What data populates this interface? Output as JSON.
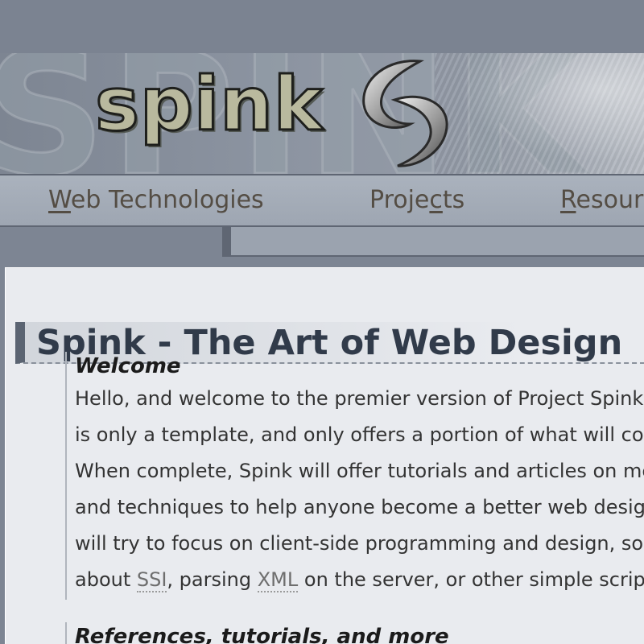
{
  "banner": {
    "logo_text": "spink",
    "ghost_text": "SPINK"
  },
  "nav": {
    "items": [
      {
        "label_key": "W",
        "label_rest": "eb Technologies"
      },
      {
        "label_pre": "Proje",
        "label_key": "c",
        "label_rest": "ts"
      },
      {
        "label_key": "R",
        "label_rest": "esources"
      }
    ]
  },
  "main": {
    "title": "Spink - The Art of Web Design",
    "sections": [
      {
        "heading": "Welcome",
        "lines": [
          "Hello, and welcome to the premier version of Project Spink. This",
          "is only a template, and only offers a portion of what will come.",
          "When complete, Spink will offer tutorials and articles on methods",
          "and techniques to help anyone become a better web designer. We",
          "will try to focus on client-side programming and design, so learn"
        ],
        "last_line": {
          "before": "about ",
          "abbr1": "SSI",
          "middle": ", parsing ",
          "abbr2": "XML",
          "after": " on the server, or other simple scripts."
        }
      },
      {
        "heading": "References, tutorials, and more"
      }
    ]
  }
}
